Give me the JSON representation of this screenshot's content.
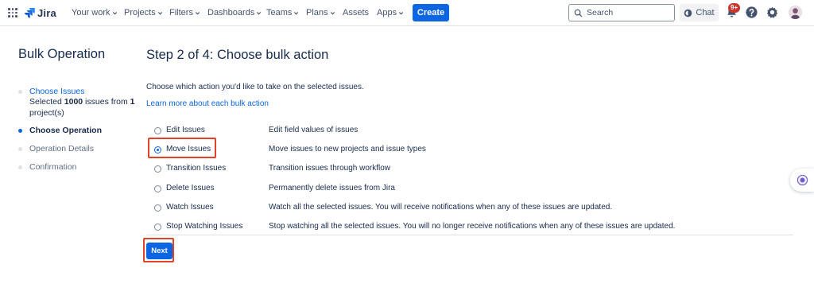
{
  "header": {
    "product": "Jira",
    "nav": [
      {
        "label": "Your work"
      },
      {
        "label": "Projects"
      },
      {
        "label": "Filters"
      },
      {
        "label": "Dashboards"
      },
      {
        "label": "Teams"
      },
      {
        "label": "Plans"
      },
      {
        "label": "Assets"
      },
      {
        "label": "Apps"
      }
    ],
    "create_label": "Create",
    "search_placeholder": "Search",
    "chat_label": "Chat",
    "notifications_badge": "9+"
  },
  "sidebar": {
    "title": "Bulk Operation",
    "steps": [
      {
        "label": "Choose Issues",
        "sub_prefix": "Selected ",
        "sub_count": "1000",
        "sub_mid": " issues from ",
        "sub_projects": "1",
        "sub_suffix": "project(s)"
      },
      {
        "label": "Choose Operation"
      },
      {
        "label": "Operation Details"
      },
      {
        "label": "Confirmation"
      }
    ]
  },
  "main": {
    "title": "Step 2 of 4: Choose bulk action",
    "intro": "Choose which action you'd like to take on the selected issues.",
    "learn_more": "Learn more about each bulk action",
    "operations": [
      {
        "label": "Edit Issues",
        "description": "Edit field values of issues",
        "selected": false
      },
      {
        "label": "Move Issues",
        "description": "Move issues to new projects and issue types",
        "selected": true
      },
      {
        "label": "Transition Issues",
        "description": "Transition issues through workflow",
        "selected": false
      },
      {
        "label": "Delete Issues",
        "description": "Permanently delete issues from Jira",
        "selected": false
      },
      {
        "label": "Watch Issues",
        "description": "Watch all the selected issues. You will receive notifications when any of these issues are updated.",
        "selected": false
      },
      {
        "label": "Stop Watching Issues",
        "description": "Stop watching all the selected issues. You will no longer receive notifications when any of these issues are updated.",
        "selected": false
      }
    ],
    "next_label": "Next"
  },
  "colors": {
    "brand_blue": "#0c66e4",
    "highlight_red": "#e2412a",
    "badge_red": "#c9372c"
  }
}
